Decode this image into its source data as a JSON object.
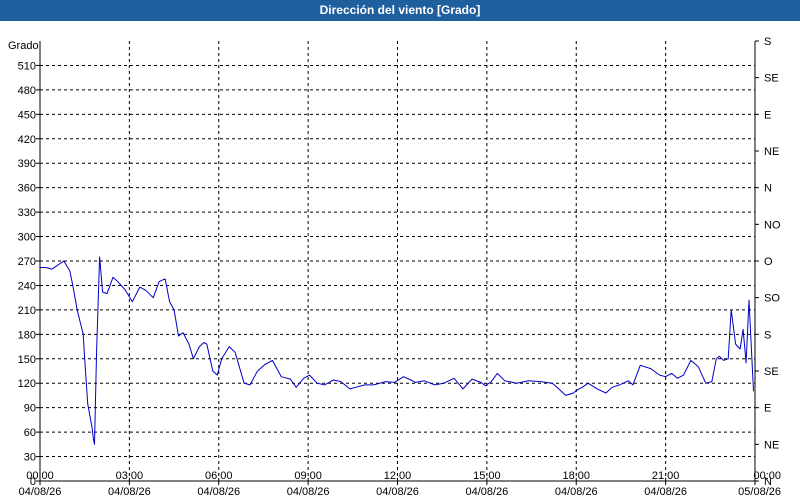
{
  "window": {
    "title": "Dirección del viento [Grado]"
  },
  "chart_data": {
    "type": "line",
    "title": "Dirección del viento [Grado]",
    "ylabel": "Grado",
    "ylim": [
      0,
      540
    ],
    "grid": true,
    "y_ticks": [
      0,
      30,
      60,
      90,
      120,
      150,
      180,
      210,
      240,
      270,
      300,
      330,
      360,
      390,
      420,
      450,
      480,
      510
    ],
    "right_axis": {
      "ticks": [
        {
          "value": 0,
          "label": "N"
        },
        {
          "value": 45,
          "label": "NE"
        },
        {
          "value": 90,
          "label": "E"
        },
        {
          "value": 135,
          "label": "SE"
        },
        {
          "value": 180,
          "label": "S"
        },
        {
          "value": 225,
          "label": "SO"
        },
        {
          "value": 270,
          "label": "O"
        },
        {
          "value": 315,
          "label": "NO"
        },
        {
          "value": 360,
          "label": "N"
        },
        {
          "value": 405,
          "label": "NE"
        },
        {
          "value": 450,
          "label": "E"
        },
        {
          "value": 495,
          "label": "SE"
        },
        {
          "value": 540,
          "label": "S"
        }
      ]
    },
    "x_range": [
      "04/08/26 00:00",
      "05/08/26 00:00"
    ],
    "x_ticks": [
      {
        "hour": 0,
        "time": "00:00",
        "date": "04/08/26"
      },
      {
        "hour": 3,
        "time": "03:00",
        "date": "04/08/26"
      },
      {
        "hour": 6,
        "time": "06:00",
        "date": "04/08/26"
      },
      {
        "hour": 9,
        "time": "09:00",
        "date": "04/08/26"
      },
      {
        "hour": 12,
        "time": "12:00",
        "date": "04/08/26"
      },
      {
        "hour": 15,
        "time": "15:00",
        "date": "04/08/26"
      },
      {
        "hour": 18,
        "time": "18:00",
        "date": "04/08/26"
      },
      {
        "hour": 21,
        "time": "21:00",
        "date": "04/08/26"
      },
      {
        "hour": 24,
        "time": "00:00",
        "date": "05/08/26"
      }
    ],
    "colors": {
      "line": "#0000c8",
      "grid": "#000000",
      "background": "#ffffff",
      "title_bar": "#1f5f9d"
    },
    "series": [
      {
        "x": [
          0,
          0.2,
          0.4,
          0.6,
          0.8,
          1.0,
          1.1,
          1.25,
          1.35,
          1.45,
          1.5,
          1.6,
          1.75,
          1.8,
          1.83,
          1.9,
          2.0,
          2.1,
          2.25,
          2.45,
          2.6,
          2.85,
          3.1,
          3.35,
          3.55,
          3.8,
          4.0,
          4.2,
          4.35,
          4.5,
          4.65,
          4.8,
          5.0,
          5.15,
          5.35,
          5.5,
          5.6,
          5.8,
          5.95,
          6.1,
          6.35,
          6.55,
          6.85,
          7.05,
          7.3,
          7.55,
          7.8,
          8.1,
          8.4,
          8.6,
          8.85,
          9.05,
          9.3,
          9.55,
          9.85,
          10.1,
          10.4,
          10.6,
          10.9,
          11.2,
          11.6,
          11.9,
          12.2,
          12.45,
          12.6,
          12.9,
          13.25,
          13.55,
          13.9,
          14.2,
          14.5,
          14.8,
          14.95,
          15.15,
          15.35,
          15.6,
          16.0,
          16.4,
          16.8,
          17.2,
          17.35,
          17.65,
          17.9,
          18.05,
          18.2,
          18.4,
          18.7,
          19.0,
          19.2,
          19.45,
          19.75,
          19.9,
          20.15,
          20.5,
          20.8,
          21.0,
          21.2,
          21.4,
          21.6,
          21.85,
          22.1,
          22.35,
          22.55,
          22.7,
          22.8,
          22.95,
          23.1,
          23.2,
          23.35,
          23.5,
          23.6,
          23.7,
          23.8,
          23.95
        ],
        "y": [
          262,
          262,
          260,
          265,
          270,
          258,
          240,
          210,
          195,
          180,
          150,
          95,
          65,
          50,
          45,
          160,
          275,
          232,
          230,
          250,
          245,
          235,
          220,
          238,
          234,
          225,
          245,
          248,
          220,
          210,
          178,
          182,
          168,
          150,
          165,
          170,
          168,
          135,
          130,
          150,
          165,
          158,
          120,
          118,
          135,
          143,
          148,
          128,
          125,
          115,
          126,
          130,
          120,
          118,
          124,
          122,
          113,
          115,
          118,
          118,
          122,
          121,
          128,
          124,
          121,
          123,
          118,
          120,
          126,
          113,
          125,
          121,
          117,
          122,
          132,
          123,
          120,
          123,
          122,
          120,
          115,
          105,
          108,
          112,
          115,
          120,
          113,
          108,
          115,
          118,
          123,
          118,
          142,
          138,
          130,
          128,
          132,
          126,
          130,
          148,
          140,
          120,
          122,
          150,
          153,
          148,
          150,
          210,
          168,
          162,
          186,
          145,
          222,
          110
        ]
      }
    ]
  }
}
